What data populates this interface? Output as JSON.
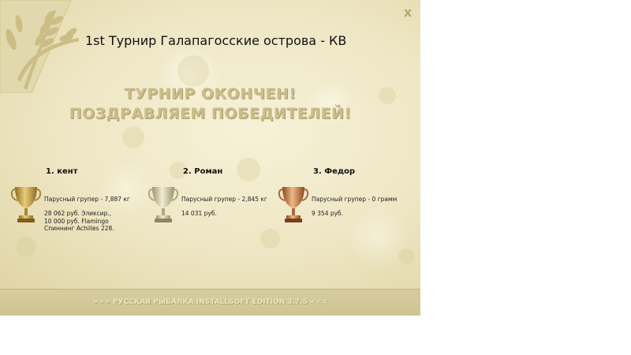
{
  "window": {
    "close_label": "x",
    "title": "1st Турнир Галапагосские острова - КВ"
  },
  "headline": {
    "line1": "ТУРНИР ОКОНЧЕН!",
    "line2": "ПОЗДРАВЛЯЕМ ПОБЕДИТЕЛЕЙ!"
  },
  "winners": [
    {
      "place_name": "1. кент",
      "catch": "Парусный групер - 7,887 кг",
      "prize_lines": [
        "28 062 руб. Эликсир.,",
        "10 000 руб. Flamingo",
        "Спиннинг Achilles 228."
      ],
      "cup": "gold-trophy-icon"
    },
    {
      "place_name": "2. Роман",
      "catch": "Парусный групер - 2,845 кг",
      "prize_lines": [
        "14 031 руб."
      ],
      "cup": "silver-trophy-icon"
    },
    {
      "place_name": "3. Федор",
      "catch": "Парусный групер - 0 грамм",
      "prize_lines": [
        "9 354 руб."
      ],
      "cup": "bronze-trophy-icon"
    }
  ],
  "footer": {
    "text": ">>> РУССКАЯ РЫБАЛКА INSTALLSOFT EDITION 3.7.5 <<<"
  },
  "colors": {
    "parchment": "#eee6c3",
    "footer": "#d3c997",
    "headline": "#cbbe8c",
    "gold": "#c9a24a",
    "silver": "#c8c09a",
    "bronze": "#c07a45"
  }
}
